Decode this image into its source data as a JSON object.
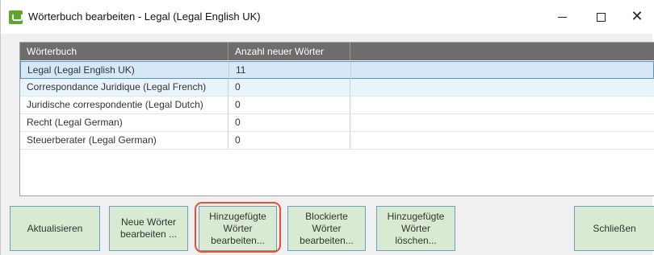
{
  "window": {
    "title": "Wörterbuch bearbeiten - Legal (Legal English UK)",
    "accent_color": "#5fa630"
  },
  "grid": {
    "columns": [
      "Wörterbuch",
      "Anzahl neuer Wörter"
    ],
    "rows": [
      {
        "name": "Legal (Legal English UK)",
        "count": "11",
        "state": "selected"
      },
      {
        "name": "Correspondance Juridique (Legal French)",
        "count": "0",
        "state": "hover"
      },
      {
        "name": "Juridische correspondentie (Legal Dutch)",
        "count": "0",
        "state": "normal"
      },
      {
        "name": "Recht (Legal German)",
        "count": "0",
        "state": "normal"
      },
      {
        "name": "Steuerberater (Legal German)",
        "count": "0",
        "state": "normal"
      }
    ]
  },
  "buttons": {
    "refresh": "Aktualisieren",
    "edit_new": "Neue Wörter\nbearbeiten ...",
    "edit_added": "Hinzugefügte\nWörter\nbearbeiten...",
    "edit_blocked": "Blockierte\nWörter\nbearbeiten...",
    "delete_added": "Hinzugefügte\nWörter\nlöschen...",
    "close": "Schließen"
  },
  "highlight_color": "#e8502e"
}
